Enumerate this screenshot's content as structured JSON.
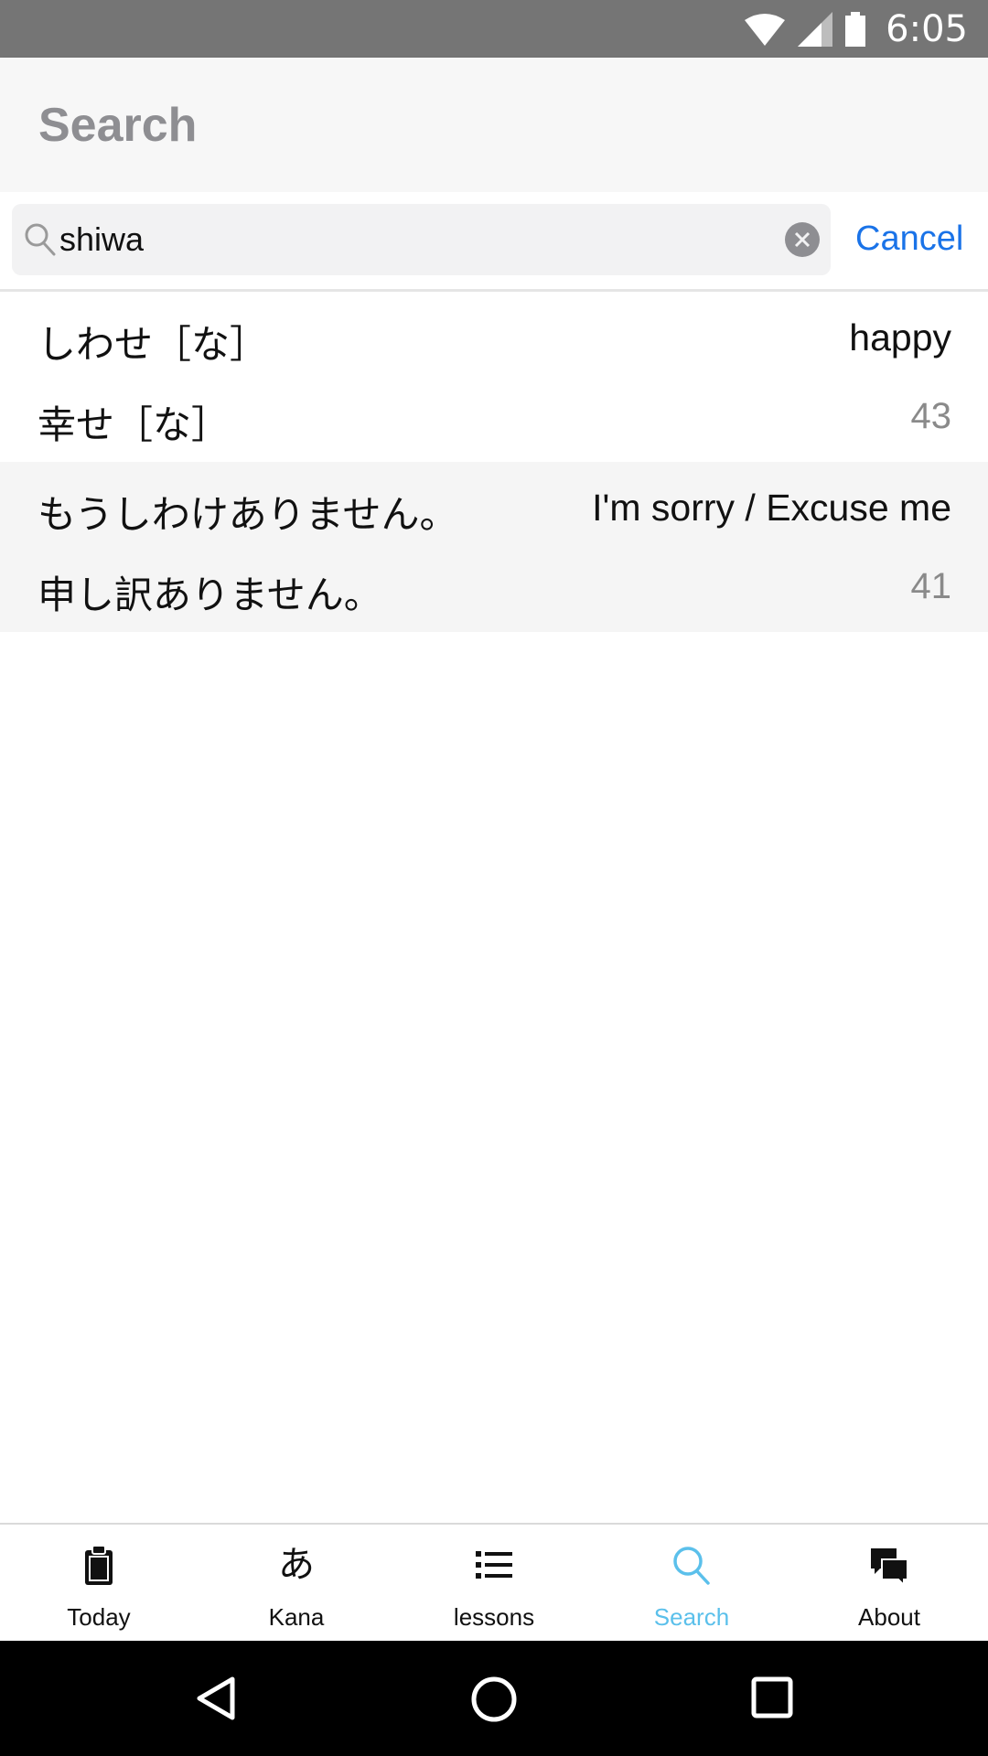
{
  "status_bar": {
    "time": "6:05"
  },
  "app_bar": {
    "title": "Search"
  },
  "search": {
    "value": "shiwa",
    "cancel_label": "Cancel"
  },
  "results": [
    {
      "kana": "しわせ［な］",
      "meaning": "happy",
      "kanji": "幸せ［な］",
      "lesson": "43"
    },
    {
      "kana": "もうしわけありません。",
      "meaning": "I'm sorry / Excuse me",
      "kanji": "申し訳ありません。",
      "lesson": "41"
    }
  ],
  "tabs": [
    {
      "label": "Today",
      "icon": "clipboard-icon"
    },
    {
      "label": "Kana",
      "icon": "hiragana-a-icon",
      "glyph": "あ"
    },
    {
      "label": "lessons",
      "icon": "list-icon"
    },
    {
      "label": "Search",
      "icon": "search-icon",
      "active": true
    },
    {
      "label": "About",
      "icon": "chat-bubbles-icon"
    }
  ],
  "colors": {
    "accent": "#5bc0eb",
    "cancel": "#1a73e8",
    "status_bar": "#757575"
  }
}
